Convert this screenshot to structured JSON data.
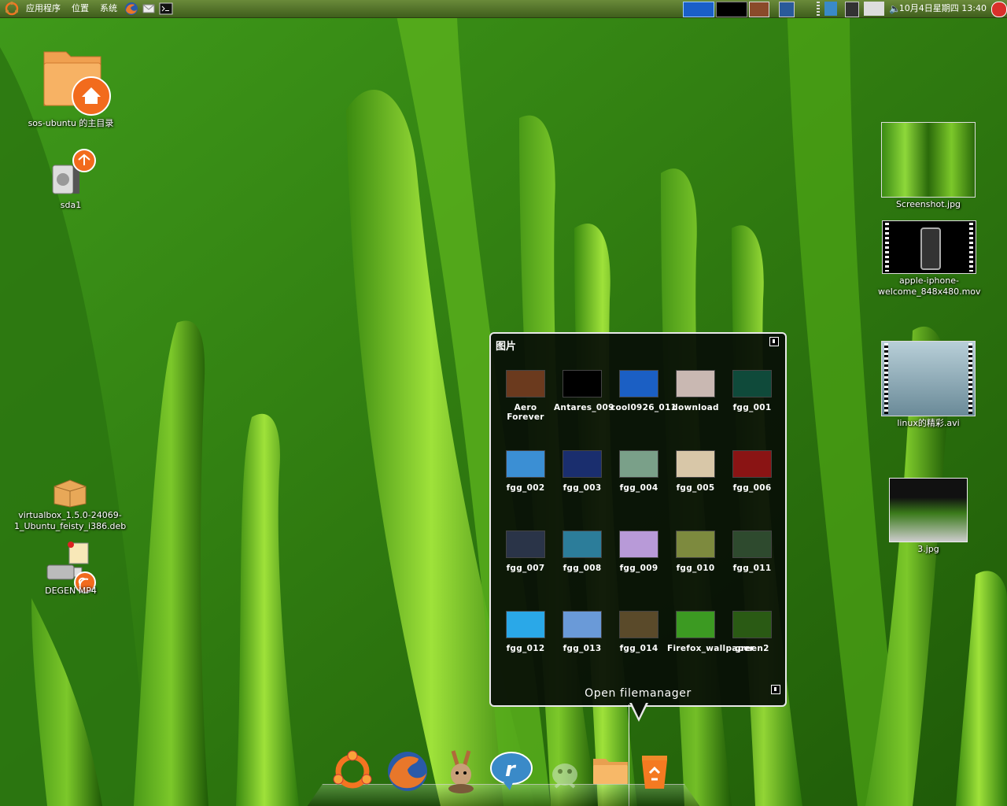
{
  "panel": {
    "menus": [
      "应用程序",
      "位置",
      "系统"
    ],
    "clock": "10月4日星期四 13:40"
  },
  "desktop": {
    "left_icons": [
      {
        "label": "sos-ubuntu 的主目录",
        "icon": "home-folder-icon"
      },
      {
        "label": "sda1",
        "icon": "drive-icon"
      },
      {
        "label": "virtualbox_1.5.0-24069-1_Ubuntu_feisty_i386.deb",
        "icon": "package-icon"
      },
      {
        "label": "DEGEN MP4",
        "icon": "usb-drive-icon"
      }
    ],
    "right_icons": [
      {
        "label": "Screenshot.jpg",
        "icon": "image-thumbnail-icon"
      },
      {
        "label": "apple-iphone-welcome_848x480.mov",
        "icon": "video-thumbnail-icon"
      },
      {
        "label": "linux的精彩.avi",
        "icon": "video-thumbnail-icon"
      },
      {
        "label": "3.jpg",
        "icon": "image-thumbnail-icon"
      }
    ]
  },
  "stack": {
    "title": "图片",
    "open_label": "Open filemanager",
    "items": [
      {
        "label": "Aero Forever",
        "color": "#6b3a1e"
      },
      {
        "label": "Antares_009",
        "color": "#000000"
      },
      {
        "label": "cool0926_011",
        "color": "#1b5fc4"
      },
      {
        "label": "download",
        "color": "#c9b8b2"
      },
      {
        "label": "fgg_001",
        "color": "#0f4a3a"
      },
      {
        "label": "fgg_002",
        "color": "#3b8fd4"
      },
      {
        "label": "fgg_003",
        "color": "#1a2e6e"
      },
      {
        "label": "fgg_004",
        "color": "#7aa089"
      },
      {
        "label": "fgg_005",
        "color": "#d8c7a8"
      },
      {
        "label": "fgg_006",
        "color": "#8a1414"
      },
      {
        "label": "fgg_007",
        "color": "#2a3448"
      },
      {
        "label": "fgg_008",
        "color": "#2c7d9a"
      },
      {
        "label": "fgg_009",
        "color": "#b89ad8"
      },
      {
        "label": "fgg_010",
        "color": "#7d8a3e"
      },
      {
        "label": "fgg_011",
        "color": "#2e4a2e"
      },
      {
        "label": "fgg_012",
        "color": "#2aa8e8"
      },
      {
        "label": "fgg_013",
        "color": "#6a9ad8"
      },
      {
        "label": "fgg_014",
        "color": "#5a4a2a"
      },
      {
        "label": "Firefox_wallpaper",
        "color": "#3c9a22"
      },
      {
        "label": "green2",
        "color": "#2a5a14"
      }
    ]
  },
  "dock": [
    "ubuntu-icon",
    "firefox-icon",
    "amule-icon",
    "realplayer-icon",
    "gimp-icon",
    "folder-icon",
    "trash-icon"
  ]
}
